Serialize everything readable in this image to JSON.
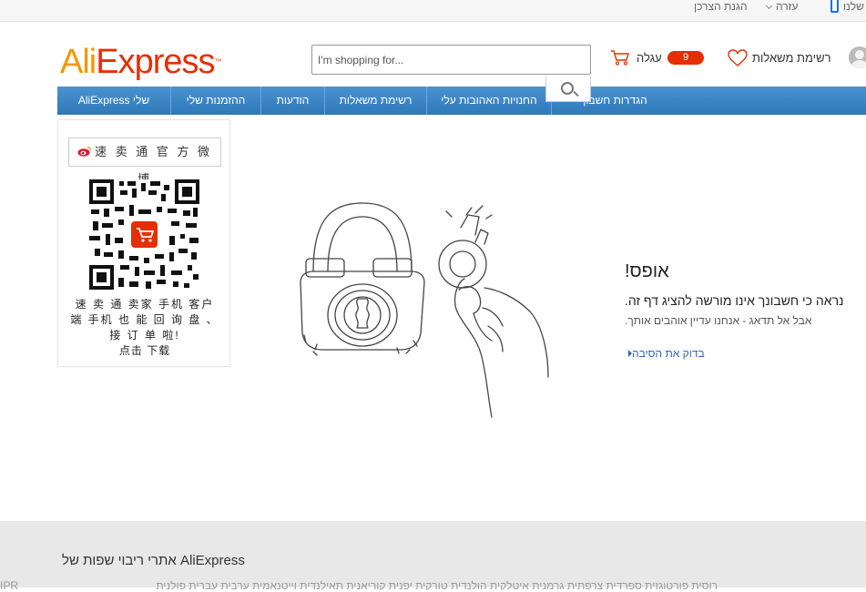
{
  "topbar": {
    "buyer_protection": "הגנת הצרכן",
    "help": "עזרה",
    "app_label": "שלנו"
  },
  "header": {
    "logo_ali": "Ali",
    "logo_express": "Express",
    "logo_tm": "™",
    "search_placeholder": "I'm shopping for...",
    "cart_label": "עגלה",
    "cart_count": "9",
    "wishlist_label": "רשימת משאלות"
  },
  "nav": {
    "tabs": [
      {
        "label": "AliExpress שלי"
      },
      {
        "label": "ההזמנות שלי"
      },
      {
        "label": "הודעות"
      },
      {
        "label": "רשימת משאלות"
      },
      {
        "label": "החנויות האהובות עלי"
      },
      {
        "label": "הגדרות חשבון"
      }
    ]
  },
  "sidebar": {
    "weibo_label": "速 卖 通 官 方 微 博",
    "promo_text": "速 卖 通 卖家 手机 客户 端 手机 也 能 回 询 盘 、 接 订 单 啦!",
    "download_text": "点击 下载"
  },
  "main": {
    "title": "אופס!",
    "message": "נראה כי חשבונך אינו מורשה להציג דף זה.",
    "sub_message": "אבל אל תדאג - אנחנו עדיין אוהבים אותך.",
    "check_reason_link": "בדוק את הסיבה"
  },
  "footer": {
    "title": "AliExpress אתרי ריבוי שפות של",
    "sites": "רוסית פורטוגזית ספרדית צרפתית גרמנית איטלקית הולנדית טורקית יפנית קוריאנית תאילנדית וייטנאמית ערבית עברית פולנית",
    "ipr": "IPR"
  },
  "colors": {
    "nav_blue": "#3a84c4",
    "brand_orange": "#f39800",
    "brand_red": "#e62e04",
    "link_blue": "#2a67b5"
  },
  "icons": [
    "phone-icon",
    "chevron-down-icon",
    "search-icon",
    "cart-icon",
    "heart-icon",
    "user-avatar",
    "weibo-icon",
    "qr-code",
    "lock-illustration",
    "arrow-right-icon"
  ]
}
